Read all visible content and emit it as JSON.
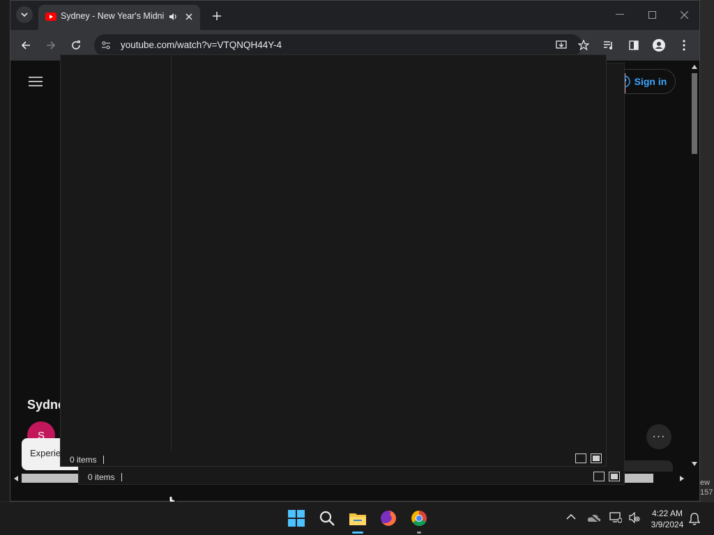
{
  "browser": {
    "tab_title": "Sydney - New Year's Midnight",
    "url": "youtube.com/watch?v=VTQNQH44Y-4"
  },
  "youtube": {
    "sign_in_label": "Sign in",
    "video_title_fragment": "Sydne",
    "channel_avatar_letter": "S",
    "toast_fragment": "Experie",
    "partial_button_fragment": "e",
    "more_actions_label": "···"
  },
  "explorer_front": {
    "status": "0 items"
  },
  "explorer_back": {
    "status": "0 items"
  },
  "desktop": {
    "right_text_1": "ew",
    "right_text_2": "157"
  },
  "taskbar": {
    "time": "4:22 AM",
    "date": "3/9/2024"
  },
  "colors": {
    "youtube_red": "#ff0000",
    "link_blue": "#3ea6ff",
    "avatar_pink": "#c2185b"
  }
}
